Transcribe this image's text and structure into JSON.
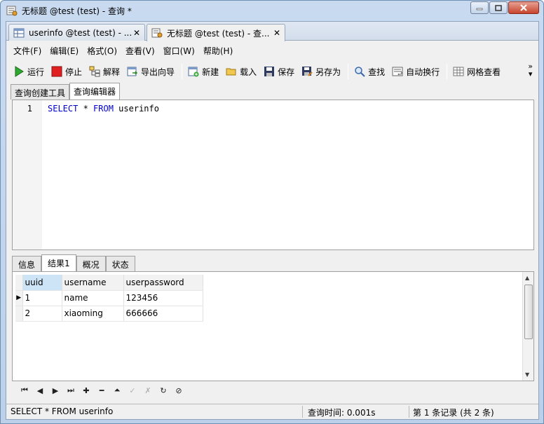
{
  "window": {
    "title": "无标题 @test (test) - 查询 *"
  },
  "doc_tabs": [
    {
      "label": "userinfo @test (test) - ...",
      "icon": "table-icon",
      "active": false
    },
    {
      "label": "无标题 @test (test) - 查...",
      "icon": "query-icon",
      "active": true
    }
  ],
  "menu": [
    "文件(F)",
    "编辑(E)",
    "格式(O)",
    "查看(V)",
    "窗口(W)",
    "帮助(H)"
  ],
  "toolbar": {
    "run": "运行",
    "stop": "停止",
    "explain": "解释",
    "export_wizard": "导出向导",
    "new": "新建",
    "load": "载入",
    "save": "保存",
    "save_as": "另存为",
    "find": "查找",
    "word_wrap": "自动换行",
    "grid_view": "网格查看"
  },
  "sub_tabs": [
    "查询创建工具",
    "查询编辑器"
  ],
  "editor": {
    "line_number": "1",
    "kw_select": "SELECT",
    "star": " * ",
    "kw_from": "FROM",
    "rest": " userinfo"
  },
  "result_tabs": [
    "信息",
    "结果1",
    "概况",
    "状态"
  ],
  "grid": {
    "columns": [
      "uuid",
      "username",
      "userpassword"
    ],
    "rows": [
      [
        "1",
        "name",
        "123456"
      ],
      [
        "2",
        "xiaoming",
        "666666"
      ]
    ]
  },
  "status": {
    "sql": "SELECT * FROM userinfo",
    "query_time": "查询时间: 0.001s",
    "record": "第 1 条记录 (共 2 条)"
  },
  "colors": {
    "keyword": "#0000cc",
    "title_bar": "#c9daf0",
    "selected_header": "#cde4f7"
  }
}
